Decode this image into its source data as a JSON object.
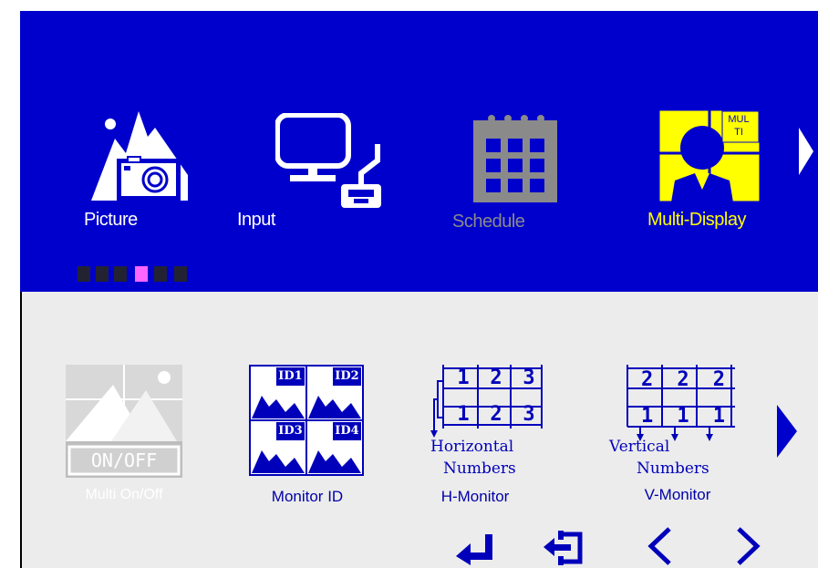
{
  "menu": {
    "items": [
      {
        "label": "Picture",
        "state": "normal"
      },
      {
        "label": "Input",
        "state": "normal"
      },
      {
        "label": "Schedule",
        "state": "disabled"
      },
      {
        "label": "Multi-Display",
        "state": "selected"
      }
    ],
    "next_icon": "triangle-right-icon",
    "page_indicator": {
      "count": 6,
      "active_index": 3
    }
  },
  "submenu": {
    "items": [
      {
        "label": "Multi On/Off",
        "badge": "ON/OFF",
        "state": "disabled"
      },
      {
        "label": "Monitor ID",
        "tiles": [
          "ID1",
          "ID2",
          "ID3",
          "ID4"
        ]
      },
      {
        "label": "H-Monitor",
        "caption1": "Horizontal",
        "caption2": "Numbers",
        "top_digits": [
          "1",
          "2",
          "3"
        ],
        "bottom_digits": [
          "1",
          "2",
          "3"
        ]
      },
      {
        "label": "V-Monitor",
        "caption1": "Vertical",
        "caption2": "Numbers",
        "top_digits": [
          "2",
          "2",
          "2"
        ],
        "bottom_digits": [
          "1",
          "1",
          "1"
        ]
      }
    ],
    "next_icon": "triangle-right-icon"
  },
  "multi_badge": "MUL TI",
  "nav": [
    "enter-icon",
    "exit-icon",
    "left-chevron-icon",
    "right-chevron-icon"
  ],
  "colors": {
    "top_bg": "#0000cc",
    "bottom_bg": "#ececec",
    "selected": "#ffff00",
    "disabled": "#888888",
    "icon_blue": "#0000bb",
    "dot_active": "#ff66ff"
  }
}
